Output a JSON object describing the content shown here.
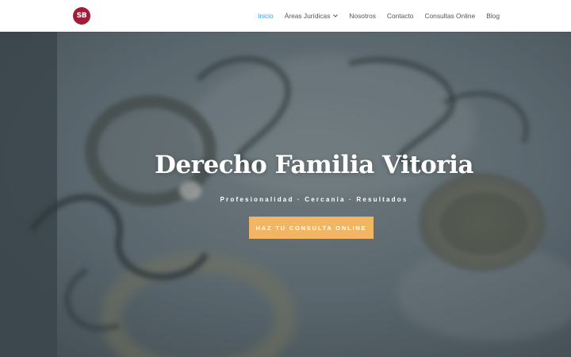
{
  "brand": {
    "logo_text": "SB",
    "logo_color": "#a01d3a"
  },
  "nav": {
    "items": [
      {
        "label": "Inicio",
        "active": true
      },
      {
        "label": "Áreas Jurídicas",
        "has_dropdown": true
      },
      {
        "label": "Nosotros"
      },
      {
        "label": "Contacto"
      },
      {
        "label": "Consultas Online"
      },
      {
        "label": "Blog"
      }
    ],
    "active_color": "#2ea3f2"
  },
  "hero": {
    "title": "Derecho Familia Vitoria",
    "subtitle": "Profesionalidad · Cercanía · Resultados",
    "cta_label": "HAZ TU CONSULTA ONLINE",
    "cta_color": "#f2b563",
    "background_image": "wedding-rings-photo"
  },
  "icons": {
    "dropdown": "chevron-down-icon"
  }
}
